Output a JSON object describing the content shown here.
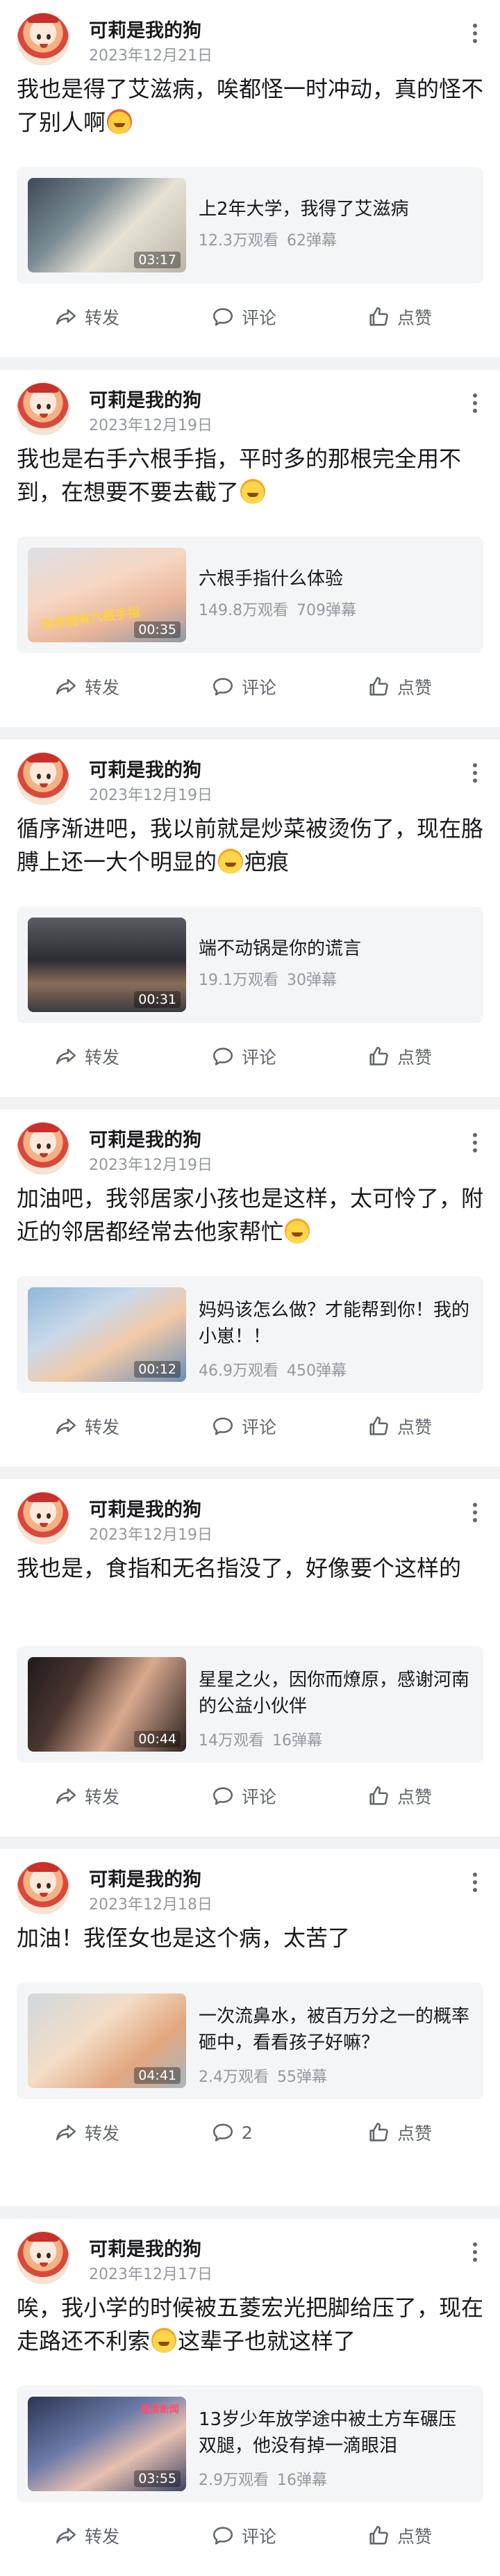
{
  "colors": {
    "background": "#f1f2f4",
    "card": "#ffffff",
    "muted": "#9499a0",
    "text": "#18191c",
    "action": "#61666d"
  },
  "icons": {
    "more": "more-vertical-icon",
    "share": "share-icon",
    "comment": "comment-icon",
    "like": "thumbs-up-icon"
  },
  "posts": [
    {
      "user": "可莉是我的狗",
      "date": "2023年12月21日",
      "text": "我也是得了艾滋病，唉都怪一时冲动，真的怪不了别人啊",
      "emoji": "crying-emoji",
      "video": {
        "title": "上2年大学，我得了艾滋病",
        "duration": "03:17",
        "views": "12.3万观看",
        "danmaku": "62弹幕"
      },
      "actions": {
        "share": "转发",
        "comment": "评论",
        "like": "点赞"
      }
    },
    {
      "user": "可莉是我的狗",
      "date": "2023年12月19日",
      "text": "我也是右手六根手指，平时多的那根完全用不到，在想要不要去截了",
      "emoji": "laughing-emoji",
      "video": {
        "title": "六根手指什么体验",
        "duration": "00:35",
        "views": "149.8万观看",
        "danmaku": "709弹幕",
        "overlay": "当你拥有六根手指"
      },
      "actions": {
        "share": "转发",
        "comment": "评论",
        "like": "点赞"
      }
    },
    {
      "user": "可莉是我的狗",
      "date": "2023年12月19日",
      "text": "循序渐进吧，我以前就是炒菜被烫伤了，现在胳膊上还一大个明显的",
      "text_after": "疤痕",
      "emoji": "laughing-emoji",
      "video": {
        "title": "端不动锅是你的谎言",
        "duration": "00:31",
        "views": "19.1万观看",
        "danmaku": "30弹幕"
      },
      "actions": {
        "share": "转发",
        "comment": "评论",
        "like": "点赞"
      }
    },
    {
      "user": "可莉是我的狗",
      "date": "2023年12月19日",
      "text": "加油吧，我邻居家小孩也是这样，太可怜了，附近的邻居都经常去他家帮忙",
      "emoji": "laughing-emoji",
      "video": {
        "title": "妈妈该怎么做？才能帮到你！我的小崽！！",
        "duration": "00:12",
        "views": "46.9万观看",
        "danmaku": "450弹幕"
      },
      "actions": {
        "share": "转发",
        "comment": "评论",
        "like": "点赞"
      }
    },
    {
      "user": "可莉是我的狗",
      "date": "2023年12月19日",
      "text": "我也是，食指和无名指没了，好像要个这样的",
      "video": {
        "title": "星星之火，因你而燎原，感谢河南的公益小伙伴",
        "duration": "00:44",
        "views": "14万观看",
        "danmaku": "16弹幕"
      },
      "actions": {
        "share": "转发",
        "comment": "评论",
        "like": "点赞"
      }
    },
    {
      "user": "可莉是我的狗",
      "date": "2023年12月18日",
      "text": "加油！我侄女也是这个病，太苦了",
      "video": {
        "title": "一次流鼻水，被百万分之一的概率砸中，看看孩子好嘛？",
        "duration": "04:41",
        "views": "2.4万观看",
        "danmaku": "55弹幕"
      },
      "actions": {
        "share": "转发",
        "comment": "2",
        "like": "点赞"
      }
    },
    {
      "user": "可莉是我的狗",
      "date": "2023年12月17日",
      "text": "唉，我小学的时候被五菱宏光把脚给压了，现在走路还不利索",
      "text_after": "这辈子也就这样了",
      "emoji": "laughing-emoji",
      "video": {
        "title": "13岁少年放学途中被土方车碾压双腿，他没有掉一滴眼泪",
        "duration": "03:55",
        "views": "2.9万观看",
        "danmaku": "16弹幕",
        "overlay": "看清新闻"
      },
      "actions": {
        "share": "转发",
        "comment": "评论",
        "like": "点赞"
      }
    }
  ]
}
